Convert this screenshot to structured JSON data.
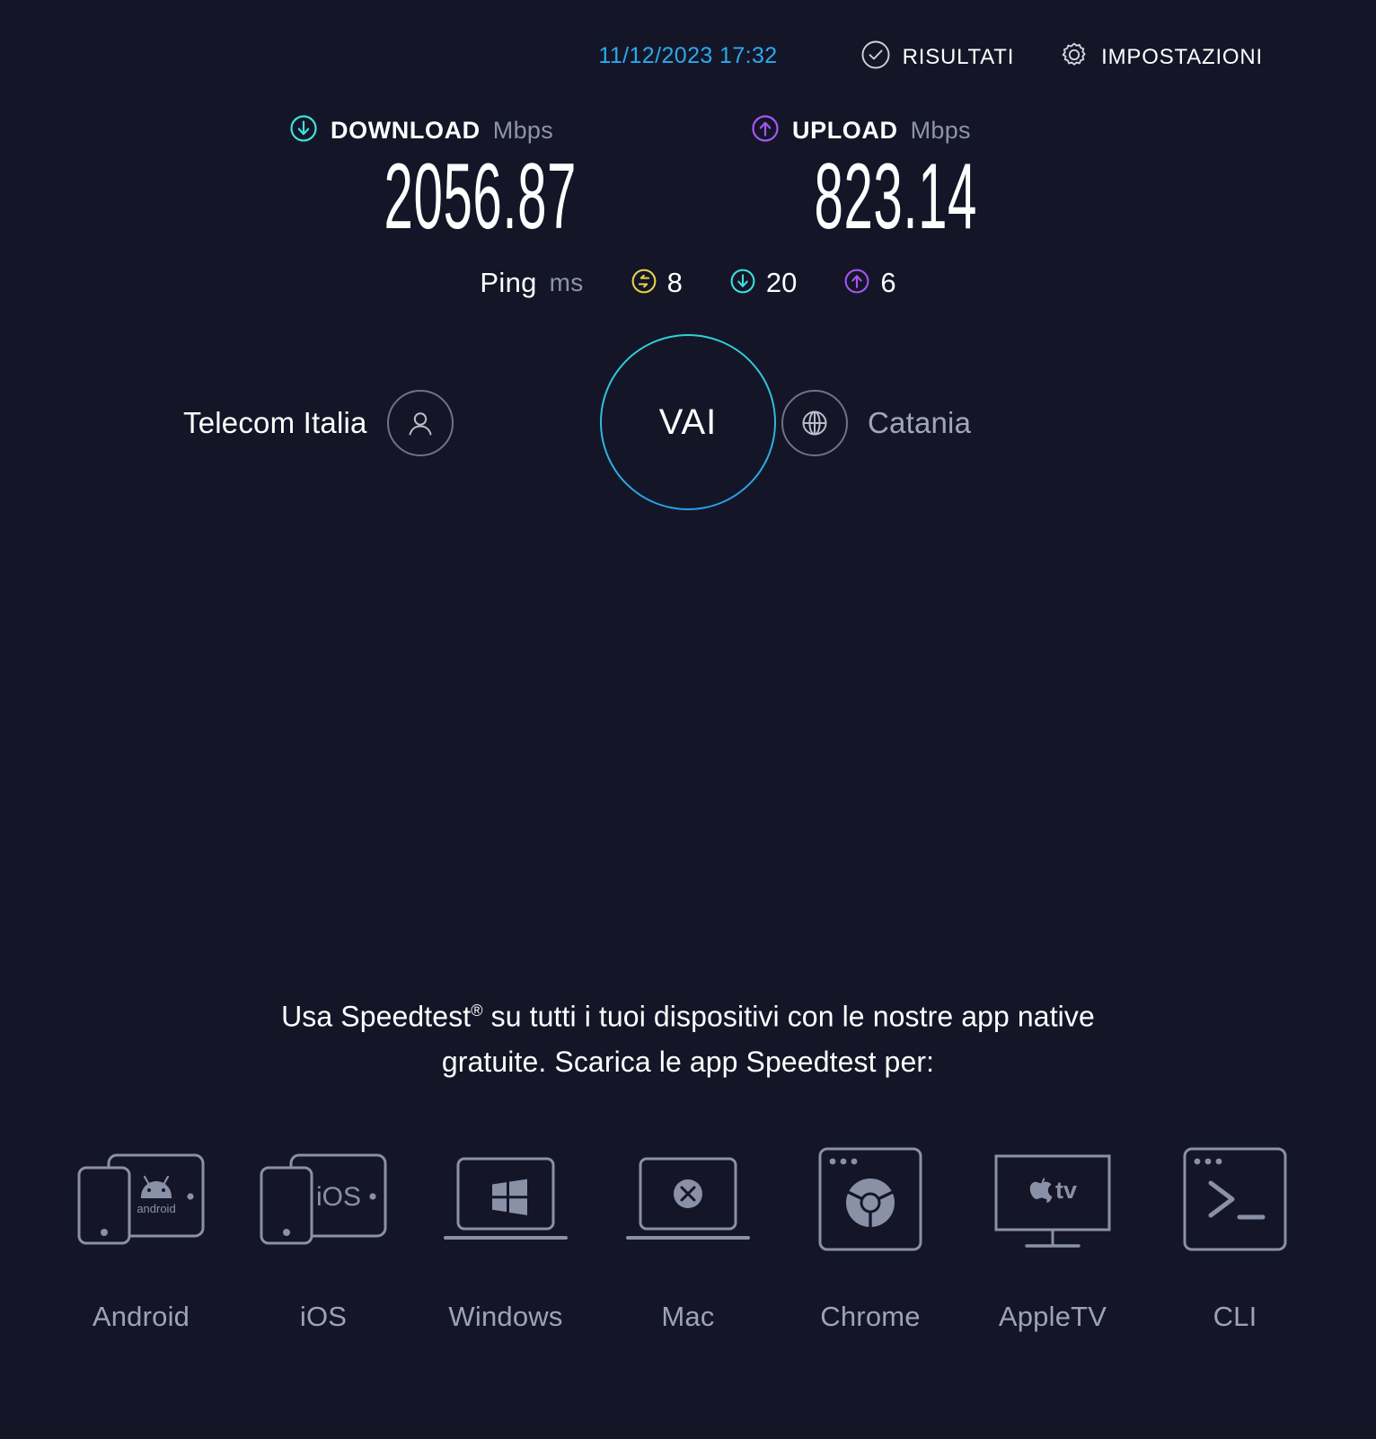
{
  "header": {
    "timestamp": "11/12/2023 17:32",
    "nav": [
      {
        "label": "RISULTATI",
        "icon": "check-circle-icon"
      },
      {
        "label": "IMPOSTAZIONI",
        "icon": "gear-icon"
      }
    ]
  },
  "results": {
    "download": {
      "title": "DOWNLOAD",
      "unit": "Mbps",
      "value": "2056.87",
      "icon": "arrow-down-circle-icon",
      "color": "#3ee0e0"
    },
    "upload": {
      "title": "UPLOAD",
      "unit": "Mbps",
      "value": "823.14",
      "icon": "arrow-up-circle-icon",
      "color": "#a855f7"
    },
    "ping": {
      "label": "Ping",
      "unit": "ms",
      "idle": {
        "value": "8",
        "icon": "exchange-circle-icon",
        "color": "#e8d44d"
      },
      "download": {
        "value": "20",
        "icon": "arrow-down-circle-icon",
        "color": "#3ee0e0"
      },
      "upload": {
        "value": "6",
        "icon": "arrow-up-circle-icon",
        "color": "#a855f7"
      }
    }
  },
  "test": {
    "go_label": "VAI",
    "isp": {
      "name": "Telecom Italia",
      "icon": "person-icon"
    },
    "server": {
      "name": "Catania",
      "icon": "globe-icon"
    }
  },
  "promo": {
    "line1_before": "Usa Speedtest",
    "line1_sup": "®",
    "line1_after": " su tutti i tuoi dispositivi con le nostre app native",
    "line2": "gratuite. Scarica le app Speedtest per:",
    "apps": [
      {
        "label": "Android",
        "icon": "android-tablet-phone-icon"
      },
      {
        "label": "iOS",
        "icon": "ios-tablet-phone-icon"
      },
      {
        "label": "Windows",
        "icon": "windows-laptop-icon"
      },
      {
        "label": "Mac",
        "icon": "mac-laptop-icon"
      },
      {
        "label": "Chrome",
        "icon": "chrome-browser-icon"
      },
      {
        "label": "AppleTV",
        "icon": "appletv-monitor-icon"
      },
      {
        "label": "CLI",
        "icon": "terminal-window-icon"
      }
    ]
  },
  "theme": {
    "background": "#141627",
    "accent_cyan": "#3ee0e0",
    "accent_purple": "#a855f7",
    "accent_blue": "#2aa9f0",
    "accent_yellow": "#e8d44d",
    "muted": "#8d93a8"
  }
}
